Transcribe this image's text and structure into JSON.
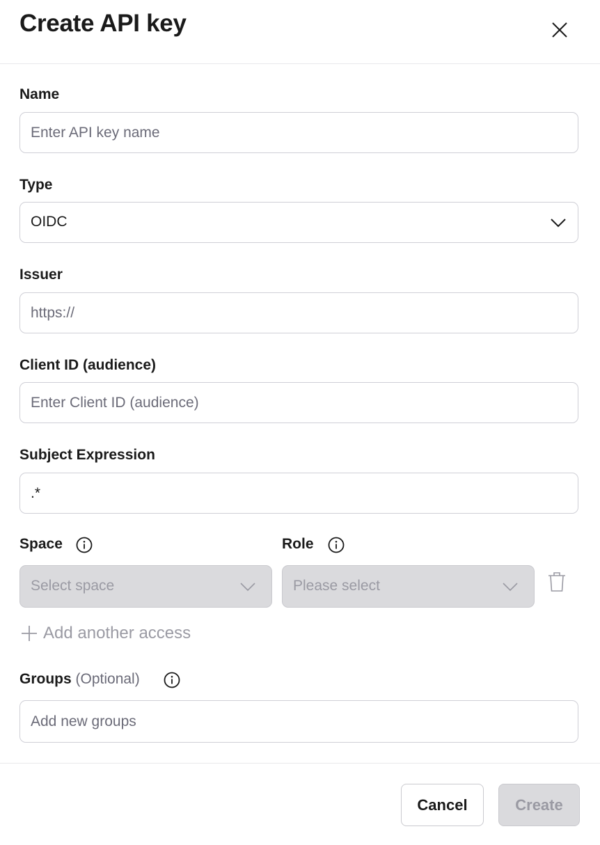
{
  "dialog": {
    "title": "Create API key"
  },
  "form": {
    "name": {
      "label": "Name",
      "placeholder": "Enter API key name",
      "value": ""
    },
    "type": {
      "label": "Type",
      "value": "OIDC"
    },
    "issuer": {
      "label": "Issuer",
      "placeholder": "https://",
      "value": ""
    },
    "client_id": {
      "label": "Client ID (audience)",
      "placeholder": "Enter Client ID (audience)",
      "value": ""
    },
    "subject_expression": {
      "label": "Subject Expression",
      "value": ".*"
    },
    "space": {
      "label": "Space",
      "placeholder": "Select space"
    },
    "role": {
      "label": "Role",
      "placeholder": "Please select"
    },
    "add_access_label": "Add another access",
    "groups": {
      "label": "Groups",
      "optional_label": "(Optional)",
      "placeholder": "Add new groups",
      "value": ""
    }
  },
  "footer": {
    "cancel_label": "Cancel",
    "create_label": "Create"
  }
}
